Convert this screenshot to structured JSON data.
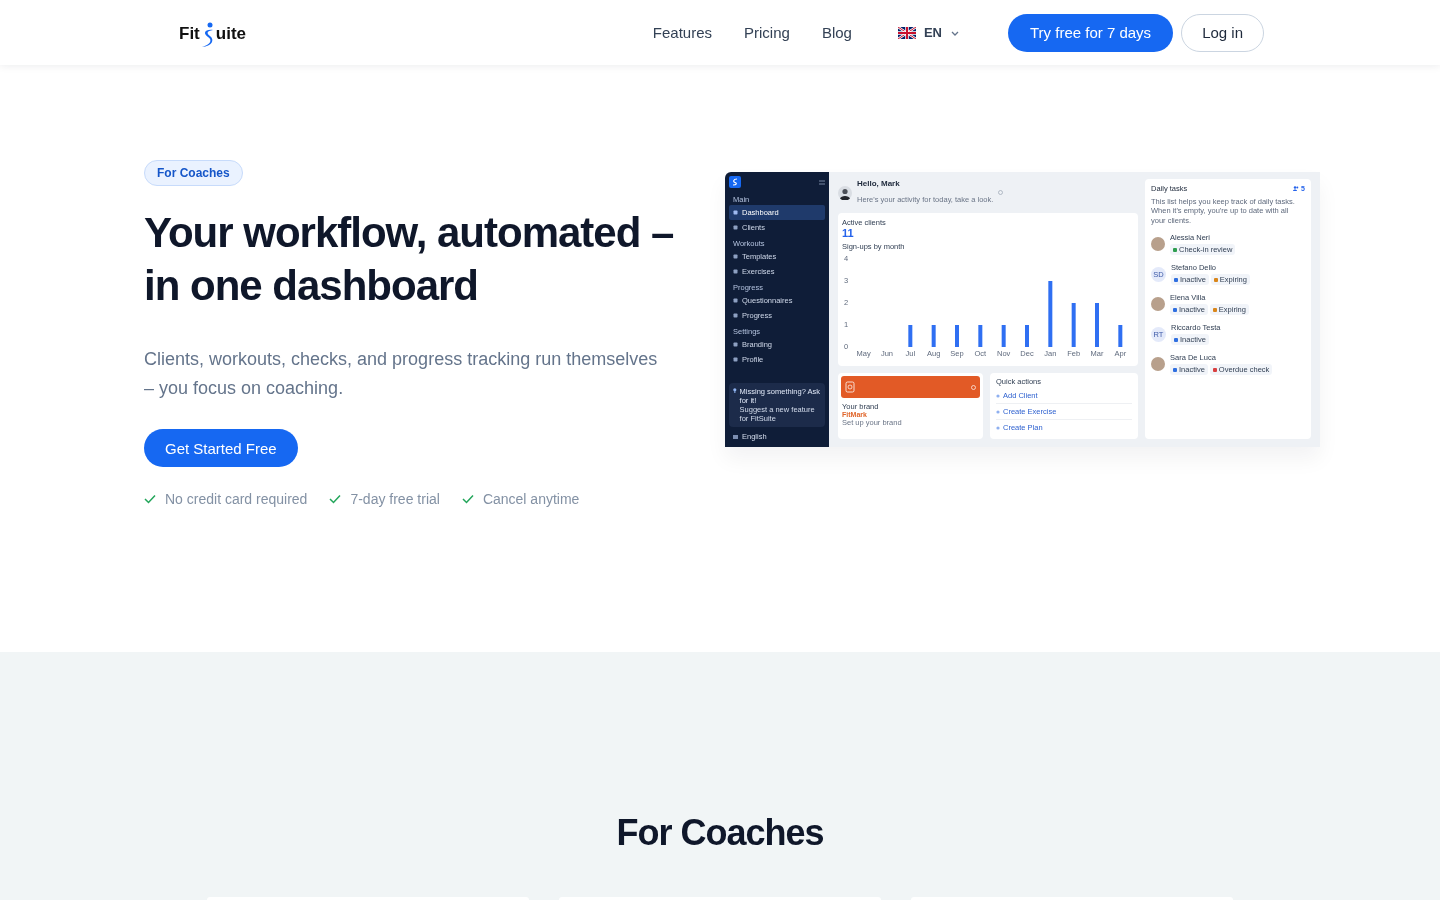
{
  "header": {
    "logo": {
      "left": "Fit",
      "right": "uite"
    },
    "nav": [
      {
        "label": "Features"
      },
      {
        "label": "Pricing"
      },
      {
        "label": "Blog"
      }
    ],
    "language": "EN",
    "cta": "Try free for 7 days",
    "login": "Log in"
  },
  "hero": {
    "badge": "For Coaches",
    "title_lines": [
      "Your workflow, automated –",
      "in one dashboard"
    ],
    "subtitle": "Clients, workouts, checks, and progress tracking run themselves – you focus on coaching.",
    "button": "Get Started Free",
    "perks": [
      "No credit card required",
      "7-day free trial",
      "Cancel anytime"
    ]
  },
  "dashboard": {
    "sidebar": {
      "sections": [
        {
          "title": "Main",
          "items": [
            {
              "label": "Dashboard",
              "selected": true
            },
            {
              "label": "Clients",
              "selected": false
            }
          ]
        },
        {
          "title": "Workouts",
          "items": [
            {
              "label": "Templates",
              "selected": false
            },
            {
              "label": "Exercises",
              "selected": false
            }
          ]
        },
        {
          "title": "Progress",
          "items": [
            {
              "label": "Questionnaires",
              "selected": false
            },
            {
              "label": "Progress",
              "selected": false
            }
          ]
        },
        {
          "title": "Settings",
          "items": [
            {
              "label": "Branding",
              "selected": false
            },
            {
              "label": "Profile",
              "selected": false
            }
          ]
        }
      ],
      "promo": {
        "title": "Missing something? Ask for it!",
        "text": "Suggest a new feature for FitSuite"
      },
      "footer": "English"
    },
    "greeting": "Hello, Mark",
    "greeting_sub": "Here's your activity for today, take a look.",
    "stats": {
      "label": "Active clients",
      "value": "11",
      "chart_title": "Sign-ups by month",
      "chart_data": {
        "type": "bar",
        "categories": [
          "May",
          "Jun",
          "Jul",
          "Aug",
          "Sep",
          "Oct",
          "Nov",
          "Dec",
          "Jan",
          "Feb",
          "Mar",
          "Apr"
        ],
        "values": [
          0,
          0,
          1,
          1,
          1,
          1,
          1,
          1,
          3,
          2,
          2,
          1
        ],
        "ylim": [
          0,
          4
        ],
        "yticks": [
          0,
          1,
          2,
          3,
          4
        ]
      }
    },
    "brand": {
      "label": "Your brand",
      "name": "FitMark",
      "note": "Set up your brand"
    },
    "quick_actions": {
      "title": "Quick actions",
      "items": [
        "Add Client",
        "Create Exercise",
        "Create Plan"
      ]
    },
    "daily_tasks": {
      "title": "Daily tasks",
      "count": "5",
      "text": "This list helps you keep track of daily tasks. When it's empty, you're up to date with all your clients.",
      "clients": [
        {
          "name": "Alessia Neri",
          "tags": [
            {
              "label": "Check-in review",
              "color": "#2e9e4f"
            }
          ]
        },
        {
          "name": "Stefano Dello",
          "initials": "SD",
          "tags": [
            {
              "label": "Inactive",
              "color": "#2f6fe0"
            },
            {
              "label": "Expiring",
              "color": "#d9861a"
            }
          ]
        },
        {
          "name": "Elena Villa",
          "tags": [
            {
              "label": "Inactive",
              "color": "#2f6fe0"
            },
            {
              "label": "Expiring",
              "color": "#d9861a"
            }
          ]
        },
        {
          "name": "Riccardo Testa",
          "initials": "RT",
          "tags": [
            {
              "label": "Inactive",
              "color": "#2f6fe0"
            }
          ]
        },
        {
          "name": "Sara De Luca",
          "tags": [
            {
              "label": "Inactive",
              "color": "#2f6fe0"
            },
            {
              "label": "Overdue check",
              "color": "#d94040"
            }
          ]
        }
      ]
    }
  },
  "section": {
    "title": "For Coaches",
    "cards": [
      {
        "kind": "card"
      },
      {
        "kind": "card"
      },
      {
        "kind": "card"
      }
    ]
  }
}
